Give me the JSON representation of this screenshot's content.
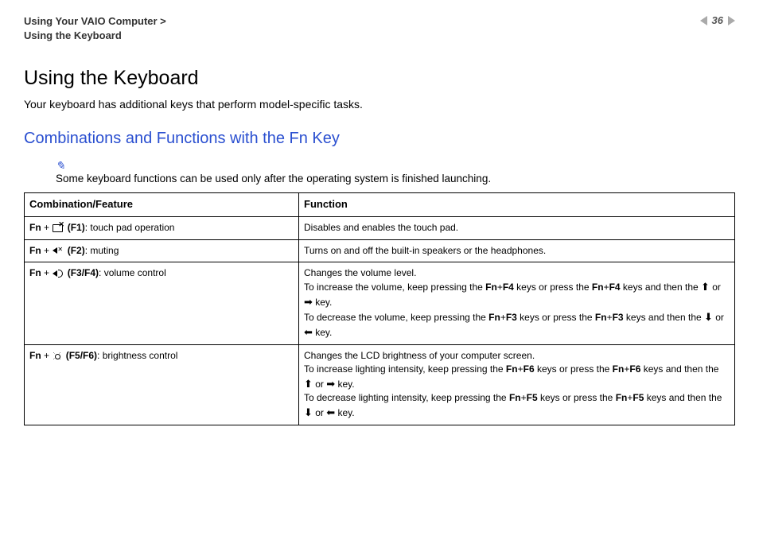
{
  "header": {
    "breadcrumb_line1": "Using Your VAIO Computer >",
    "breadcrumb_line2": "Using the Keyboard",
    "page_number": "36"
  },
  "title": "Using the Keyboard",
  "intro": "Your keyboard has additional keys that perform model-specific tasks.",
  "subtitle": "Combinations and Functions with the Fn Key",
  "note": "Some keyboard functions can be used only after the operating system is finished launching.",
  "table": {
    "head_combo": "Combination/Feature",
    "head_func": "Function",
    "rows": [
      {
        "fn": "Fn",
        "plus": " + ",
        "key": "(F1)",
        "label": ": touch pad operation",
        "func_lines": [
          "Disables and enables the touch pad."
        ]
      },
      {
        "fn": "Fn",
        "plus": " + ",
        "key": "(F2)",
        "label": ": muting",
        "func_lines": [
          "Turns on and off the built-in speakers or the headphones."
        ]
      },
      {
        "fn": "Fn",
        "plus": " + ",
        "key": "(F3/F4)",
        "label": ": volume control",
        "func_lines": [
          "Changes the volume level.",
          "To increase the volume, keep pressing the <b>Fn</b>+<b>F4</b> keys or press the <b>Fn</b>+<b>F4</b> keys and then the <span class='arrow'>&#x2B06;</span> or <span class='arrow'>&#x27A1;</span> key.",
          "To decrease the volume, keep pressing the <b>Fn</b>+<b>F3</b> keys or press the <b>Fn</b>+<b>F3</b> keys and then the <span class='arrow'>&#x2B07;</span> or <span class='arrow'>&#x2B05;</span> key."
        ]
      },
      {
        "fn": "Fn",
        "plus": " + ",
        "key": "(F5/F6)",
        "label": ": brightness control",
        "func_lines": [
          "Changes the LCD brightness of your computer screen.",
          "To increase lighting intensity, keep pressing the <b>Fn</b>+<b>F6</b> keys or press the <b>Fn</b>+<b>F6</b> keys and then the <span class='arrow'>&#x2B06;</span> or <span class='arrow'>&#x27A1;</span> key.",
          "To decrease lighting intensity, keep pressing the <b>Fn</b>+<b>F5</b> keys or press the <b>Fn</b>+<b>F5</b> keys and then the <span class='arrow'>&#x2B07;</span> or <span class='arrow'>&#x2B05;</span> key."
        ]
      }
    ]
  }
}
